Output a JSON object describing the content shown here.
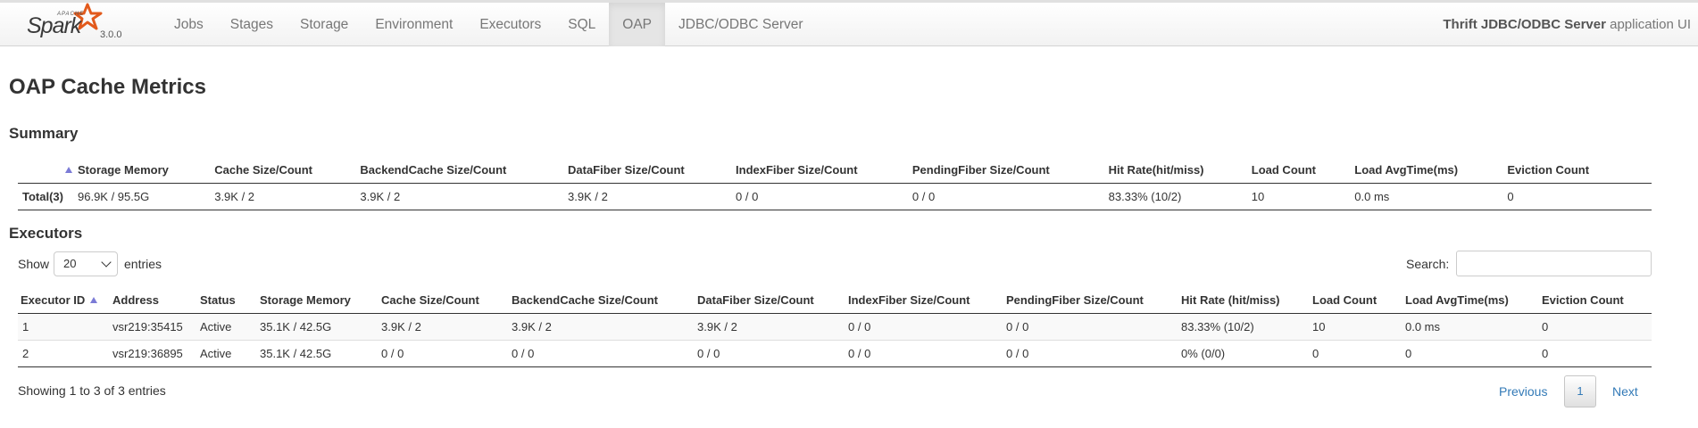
{
  "navbar": {
    "brand_apache": "APACHE",
    "brand_spark": "Spark",
    "version": "3.0.0",
    "links": [
      "Jobs",
      "Stages",
      "Storage",
      "Environment",
      "Executors",
      "SQL",
      "OAP",
      "JDBC/ODBC Server"
    ],
    "active": "OAP",
    "app_title_bold": "Thrift JDBC/ODBC Server",
    "app_title_rest": " application UI"
  },
  "page": {
    "title": "OAP Cache Metrics"
  },
  "summary": {
    "heading": "Summary",
    "columns": [
      "Storage Memory",
      "Cache Size/Count",
      "BackendCache Size/Count",
      "DataFiber Size/Count",
      "IndexFiber Size/Count",
      "PendingFiber Size/Count",
      "Hit Rate(hit/miss)",
      "Load Count",
      "Load AvgTime(ms)",
      "Eviction Count"
    ],
    "row": [
      "Total(3)",
      "96.9K / 95.5G",
      "3.9K / 2",
      "3.9K / 2",
      "3.9K / 2",
      "0 / 0",
      "0 / 0",
      "83.33% (10/2)",
      "10",
      "0.0 ms",
      "0"
    ]
  },
  "executors": {
    "heading": "Executors",
    "show_label": "Show",
    "page_size": "20",
    "entries_label": "entries",
    "search_label": "Search:",
    "search_value": "",
    "columns": [
      "Executor ID",
      "Address",
      "Status",
      "Storage Memory",
      "Cache Size/Count",
      "BackendCache Size/Count",
      "DataFiber Size/Count",
      "IndexFiber Size/Count",
      "PendingFiber Size/Count",
      "Hit Rate (hit/miss)",
      "Load Count",
      "Load AvgTime(ms)",
      "Eviction Count"
    ],
    "rows": [
      [
        "1",
        "vsr219:35415",
        "Active",
        "35.1K / 42.5G",
        "3.9K / 2",
        "3.9K / 2",
        "3.9K / 2",
        "0 / 0",
        "0 / 0",
        "83.33% (10/2)",
        "10",
        "0.0 ms",
        "0"
      ],
      [
        "2",
        "vsr219:36895",
        "Active",
        "35.1K / 42.5G",
        "0 / 0",
        "0 / 0",
        "0 / 0",
        "0 / 0",
        "0 / 0",
        "0% (0/0)",
        "0",
        "0",
        "0"
      ]
    ],
    "info": "Showing 1 to 3 of 3 entries",
    "pagination": {
      "previous": "Previous",
      "current": "1",
      "next": "Next"
    }
  },
  "colors": {
    "link": "#337ab7",
    "sort_arrow": "#7b7bd6",
    "logo_orange": "#e25a1c"
  },
  "icons": {
    "sort": "sort-ascending-icon",
    "dropdown": "chevron-down-icon",
    "logo": "spark-star-logo"
  }
}
